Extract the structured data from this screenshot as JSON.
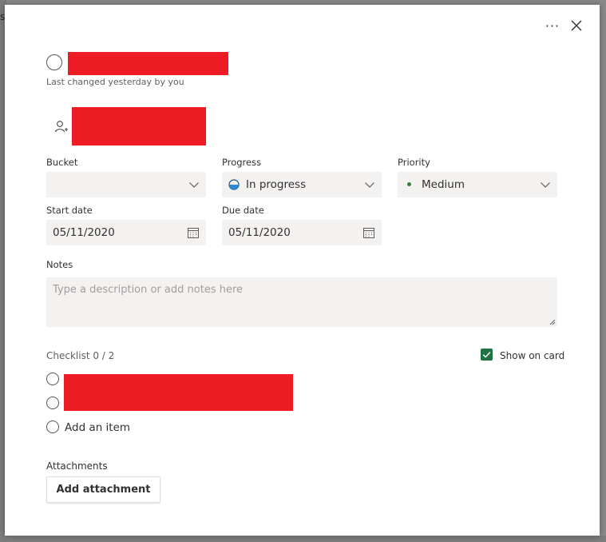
{
  "backdrop": {
    "edge_letter": "s"
  },
  "header": {
    "more_label": "···",
    "task_meta": "Last changed yesterday by you"
  },
  "fields": {
    "bucket": {
      "label": "Bucket",
      "value": ""
    },
    "progress": {
      "label": "Progress",
      "value": "In progress",
      "icon": "half-circle-progress-icon"
    },
    "priority": {
      "label": "Priority",
      "value": "Medium",
      "dot_color": "#3d7a3a"
    },
    "start_date": {
      "label": "Start date",
      "value": "05/11/2020"
    },
    "due_date": {
      "label": "Due date",
      "value": "05/11/2020"
    }
  },
  "notes": {
    "label": "Notes",
    "placeholder": "Type a description or add notes here"
  },
  "checklist": {
    "label": "Checklist 0 / 2",
    "show_on_card_label": "Show on card",
    "show_on_card_checked": true,
    "add_item_label": "Add an item"
  },
  "attachments": {
    "label": "Attachments",
    "button_label": "Add attachment"
  },
  "colors": {
    "redaction": "#ed1c24",
    "accent_green": "#217346",
    "field_bg": "#f3f2f1"
  }
}
